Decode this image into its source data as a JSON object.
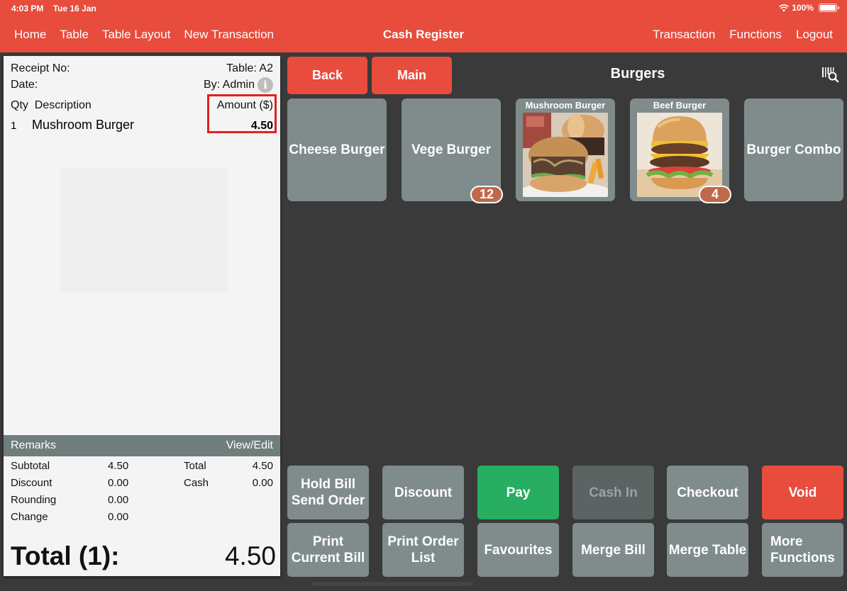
{
  "status_bar": {
    "time": "4:03 PM",
    "date": "Tue 16 Jan",
    "battery": "100%"
  },
  "nav": {
    "left": [
      "Home",
      "Table",
      "Table Layout",
      "New Transaction"
    ],
    "title": "Cash Register",
    "right": [
      "Transaction",
      "Functions",
      "Logout"
    ]
  },
  "receipt": {
    "receipt_no_label": "Receipt No:",
    "table_label": "Table: A2",
    "date_label": "Date:",
    "by_label": "By: Admin",
    "col_qty": "Qty",
    "col_description": "Description",
    "col_amount": "Amount ($)",
    "items": [
      {
        "qty": "1",
        "description": "Mushroom Burger",
        "amount": "4.50"
      }
    ],
    "remarks_label": "Remarks",
    "view_edit_label": "View/Edit",
    "summary": {
      "subtotal_label": "Subtotal",
      "subtotal": "4.50",
      "discount_label": "Discount",
      "discount": "0.00",
      "rounding_label": "Rounding",
      "rounding": "0.00",
      "change_label": "Change",
      "change": "0.00",
      "total_label": "Total",
      "total": "4.50",
      "cash_label": "Cash",
      "cash": "0.00"
    },
    "grand_total_label": "Total (1):",
    "grand_total": "4.50"
  },
  "menu": {
    "back_label": "Back",
    "main_label": "Main",
    "category_title": "Burgers",
    "tiles": [
      {
        "label": "Cheese Burger",
        "image": false
      },
      {
        "label": "Vege Burger",
        "image": false,
        "badge": "12"
      },
      {
        "label": "Mushroom Burger",
        "image": true
      },
      {
        "label": "Beef Burger",
        "image": true,
        "badge": "4"
      },
      {
        "label": "Burger Combo",
        "image": false
      }
    ]
  },
  "actions": {
    "hold_bill": "Hold Bill\nSend Order",
    "discount": "Discount",
    "pay": "Pay",
    "cash_in": "Cash In",
    "checkout": "Checkout",
    "void": "Void",
    "print_current_bill": "Print\nCurrent Bill",
    "print_order_list": "Print Order\nList",
    "favourites": "Favourites",
    "merge_bill": "Merge Bill",
    "merge_table": "Merge Table",
    "more_functions": "More\nFunctions"
  },
  "colors": {
    "brand_red": "#e74c3c",
    "pay_green": "#27ae60",
    "tile_gray": "#7f8c8b",
    "badge": "#c0694a",
    "highlight": "#e3201c"
  }
}
